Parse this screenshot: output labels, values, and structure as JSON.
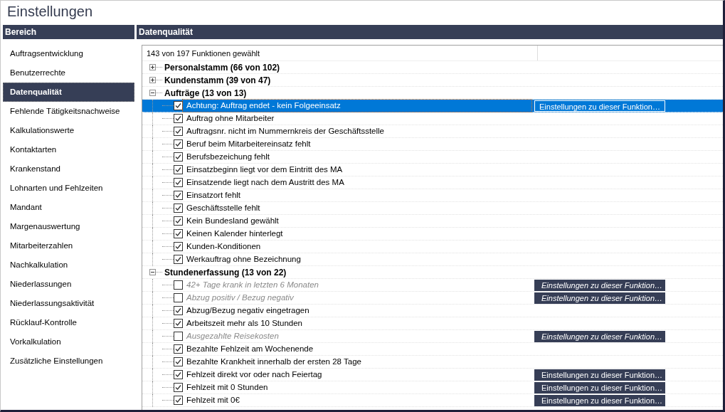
{
  "window": {
    "title": "Einstellungen"
  },
  "sidebar": {
    "header": "Bereich",
    "items": [
      {
        "label": "Auftragsentwicklung",
        "selected": false
      },
      {
        "label": "Benutzerrechte",
        "selected": false
      },
      {
        "label": "Datenqualität",
        "selected": true
      },
      {
        "label": "Fehlende Tätigkeitsnachweise",
        "selected": false
      },
      {
        "label": "Kalkulationswerte",
        "selected": false
      },
      {
        "label": "Kontaktarten",
        "selected": false
      },
      {
        "label": "Krankenstand",
        "selected": false
      },
      {
        "label": "Lohnarten und Fehlzeiten",
        "selected": false
      },
      {
        "label": "Mandant",
        "selected": false
      },
      {
        "label": "Margenauswertung",
        "selected": false
      },
      {
        "label": "Mitarbeiterzahlen",
        "selected": false
      },
      {
        "label": "Nachkalkulation",
        "selected": false
      },
      {
        "label": "Niederlassungen",
        "selected": false
      },
      {
        "label": "Niederlassungsaktivität",
        "selected": false
      },
      {
        "label": "Rücklauf-Kontrolle",
        "selected": false
      },
      {
        "label": "Vorkalkulation",
        "selected": false
      },
      {
        "label": "Zusätzliche Einstellungen",
        "selected": false
      }
    ]
  },
  "panel": {
    "header": "Datenqualität",
    "summary": "143 von 197 Funktionen gewählt",
    "tree": [
      {
        "label": "Personalstamm (66 von 102)",
        "expanded": false
      },
      {
        "label": "Kundenstamm (39 von 47)",
        "expanded": false
      },
      {
        "label": "Aufträge (13 von 13)",
        "expanded": true,
        "children": [
          {
            "label": "Achtung: Auftrag endet - kein Folgeeinsatz",
            "checked": true,
            "selected": true,
            "settings_button": "Einstellungen zu dieser Funktion…"
          },
          {
            "label": "Auftrag ohne Mitarbeiter",
            "checked": true,
            "selected": false
          },
          {
            "label": "Auftragsnr. nicht im Nummernkreis der Geschäftsstelle",
            "checked": true,
            "selected": false
          },
          {
            "label": "Beruf beim Mitarbeitereinsatz fehlt",
            "checked": true,
            "selected": false
          },
          {
            "label": "Berufsbezeichung fehlt",
            "checked": true,
            "selected": false
          },
          {
            "label": "Einsatzbeginn liegt vor dem Eintritt des MA",
            "checked": true,
            "selected": false
          },
          {
            "label": "Einsatzende liegt nach dem Austritt des MA",
            "checked": true,
            "selected": false
          },
          {
            "label": "Einsatzort fehlt",
            "checked": true,
            "selected": false
          },
          {
            "label": "Geschäftsstelle fehlt",
            "checked": true,
            "selected": false
          },
          {
            "label": "Kein Bundesland gewählt",
            "checked": true,
            "selected": false
          },
          {
            "label": "Keinen Kalender hinterlegt",
            "checked": true,
            "selected": false
          },
          {
            "label": "Kunden-Konditionen",
            "checked": true,
            "selected": false
          },
          {
            "label": "Werkauftrag ohne Bezeichnung",
            "checked": true,
            "selected": false
          }
        ]
      },
      {
        "label": "Stundenerfassung (13 von 22)",
        "expanded": true,
        "children": [
          {
            "label": "42+ Tage krank in letzten 6 Monaten",
            "checked": false,
            "selected": false,
            "settings_button": "Einstellungen zu dieser Funktion…"
          },
          {
            "label": "Abzug positiv / Bezug negativ",
            "checked": false,
            "selected": false,
            "settings_button": "Einstellungen zu dieser Funktion…"
          },
          {
            "label": "Abzug/Bezug negativ eingetragen",
            "checked": true,
            "selected": false
          },
          {
            "label": "Arbeitszeit mehr als 10 Stunden",
            "checked": true,
            "selected": false
          },
          {
            "label": "Ausgezahlte Reisekosten",
            "checked": false,
            "selected": false,
            "settings_button": "Einstellungen zu dieser Funktion…"
          },
          {
            "label": "Bezahlte Fehlzeit am Wochenende",
            "checked": true,
            "selected": false
          },
          {
            "label": "Bezahlte Krankheit innerhalb der ersten 28 Tage",
            "checked": true,
            "selected": false
          },
          {
            "label": "Fehlzeit direkt vor oder nach Feiertag",
            "checked": true,
            "selected": false,
            "settings_button": "Einstellungen zu dieser Funktion…"
          },
          {
            "label": "Fehlzeit mit 0 Stunden",
            "checked": true,
            "selected": false,
            "settings_button": "Einstellungen zu dieser Funktion…"
          },
          {
            "label": "Fehlzeit mit 0€",
            "checked": true,
            "selected": false,
            "settings_button": "Einstellungen zu dieser Funktion…"
          }
        ]
      }
    ]
  }
}
